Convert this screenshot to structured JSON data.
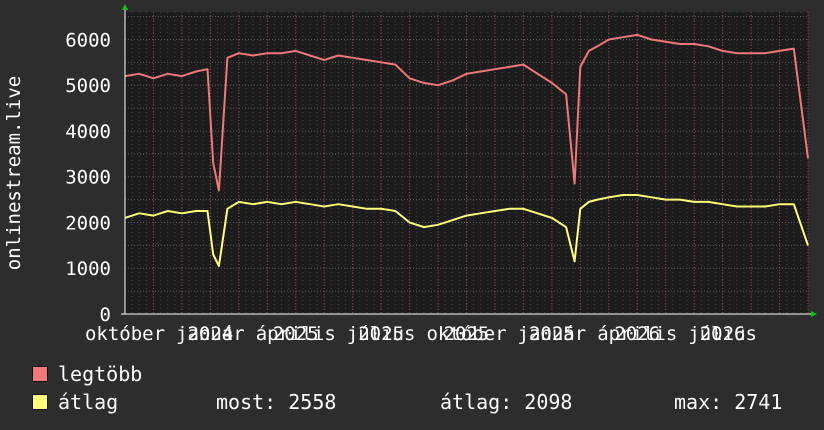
{
  "colors": {
    "background": "#2d2d2d",
    "plot_background": "#1c1c1c",
    "grid": "#5a5a5a",
    "month_grid": "#a04040",
    "axis": "#ffffff",
    "arrow": "#00cc00",
    "max_series": "#f07878",
    "avg_series": "#ffff7a"
  },
  "chart_data": {
    "type": "line",
    "ylabel": "onlinestream.live",
    "ylim": [
      0,
      6600
    ],
    "yticks": [
      "0",
      "1000",
      "2000",
      "3000",
      "4000",
      "5000",
      "6000"
    ],
    "ytick_values": [
      0,
      1000,
      2000,
      3000,
      4000,
      5000,
      6000
    ],
    "xlim": [
      0,
      24
    ],
    "xticks": [
      {
        "value": 0,
        "label": "október"
      },
      {
        "value": 3,
        "label": "január"
      },
      {
        "value": 3,
        "label": "2024"
      },
      {
        "value": 6,
        "label": "április"
      },
      {
        "value": 6,
        "label": "2025"
      },
      {
        "value": 9,
        "label": "július"
      },
      {
        "value": 9,
        "label": "2025"
      },
      {
        "value": 12,
        "label": "október"
      },
      {
        "value": 12,
        "label": "2025"
      },
      {
        "value": 15,
        "label": "január"
      },
      {
        "value": 15,
        "label": "2025"
      },
      {
        "value": 18,
        "label": "április"
      },
      {
        "value": 18,
        "label": "2026"
      },
      {
        "value": 21,
        "label": "július"
      },
      {
        "value": 21,
        "label": "2026"
      }
    ],
    "x_monthly_gridlines": [
      0,
      1,
      2,
      3,
      4,
      5,
      6,
      7,
      8,
      9,
      10,
      11,
      12,
      13,
      14,
      15,
      16,
      17,
      18,
      19,
      20,
      21,
      22,
      23,
      24
    ],
    "grid": true,
    "legend_position": "bottom-left",
    "series": [
      {
        "name": "legtöbb",
        "color": "#f07878",
        "x": [
          0,
          0.5,
          1,
          1.5,
          2,
          2.5,
          2.9,
          3.1,
          3.3,
          3.6,
          4,
          4.5,
          5,
          5.5,
          6,
          6.5,
          7,
          7.5,
          8,
          8.5,
          9,
          9.5,
          10,
          10.5,
          11,
          11.5,
          12,
          12.5,
          13,
          13.5,
          14,
          14.5,
          15,
          15.5,
          15.8,
          16,
          16.3,
          16.6,
          17,
          17.5,
          18,
          18.5,
          19,
          19.5,
          20,
          20.5,
          21,
          21.5,
          22,
          22.5,
          23,
          23.5,
          24
        ],
        "values": [
          5200,
          5250,
          5150,
          5250,
          5200,
          5300,
          5350,
          3300,
          2700,
          5600,
          5700,
          5650,
          5700,
          5700,
          5750,
          5650,
          5550,
          5650,
          5600,
          5550,
          5500,
          5450,
          5150,
          5050,
          5000,
          5100,
          5250,
          5300,
          5350,
          5400,
          5450,
          5250,
          5050,
          4800,
          2850,
          5400,
          5750,
          5850,
          6000,
          6050,
          6100,
          6000,
          5950,
          5900,
          5900,
          5850,
          5750,
          5700,
          5700,
          5700,
          5750,
          5800,
          3400
        ]
      },
      {
        "name": "átlag",
        "color": "#ffff7a",
        "x": [
          0,
          0.5,
          1,
          1.5,
          2,
          2.5,
          2.9,
          3.1,
          3.3,
          3.6,
          4,
          4.5,
          5,
          5.5,
          6,
          6.5,
          7,
          7.5,
          8,
          8.5,
          9,
          9.5,
          10,
          10.5,
          11,
          11.5,
          12,
          12.5,
          13,
          13.5,
          14,
          14.5,
          15,
          15.5,
          15.8,
          16,
          16.3,
          16.6,
          17,
          17.5,
          18,
          18.5,
          19,
          19.5,
          20,
          20.5,
          21,
          21.5,
          22,
          22.5,
          23,
          23.5,
          24
        ],
        "values": [
          2100,
          2200,
          2150,
          2250,
          2200,
          2250,
          2250,
          1300,
          1050,
          2300,
          2450,
          2400,
          2450,
          2400,
          2450,
          2400,
          2350,
          2400,
          2350,
          2300,
          2300,
          2250,
          2000,
          1900,
          1950,
          2050,
          2150,
          2200,
          2250,
          2300,
          2300,
          2200,
          2100,
          1900,
          1150,
          2300,
          2450,
          2500,
          2550,
          2600,
          2600,
          2550,
          2500,
          2500,
          2450,
          2450,
          2400,
          2350,
          2350,
          2350,
          2400,
          2400,
          1500
        ]
      }
    ]
  },
  "legend": [
    {
      "label": "legtöbb",
      "color": "#f07878"
    },
    {
      "label": "átlag",
      "color": "#ffff7a"
    }
  ],
  "stats": {
    "current": "most: 2558",
    "average": "átlag: 2098",
    "max": "max: 2741"
  }
}
